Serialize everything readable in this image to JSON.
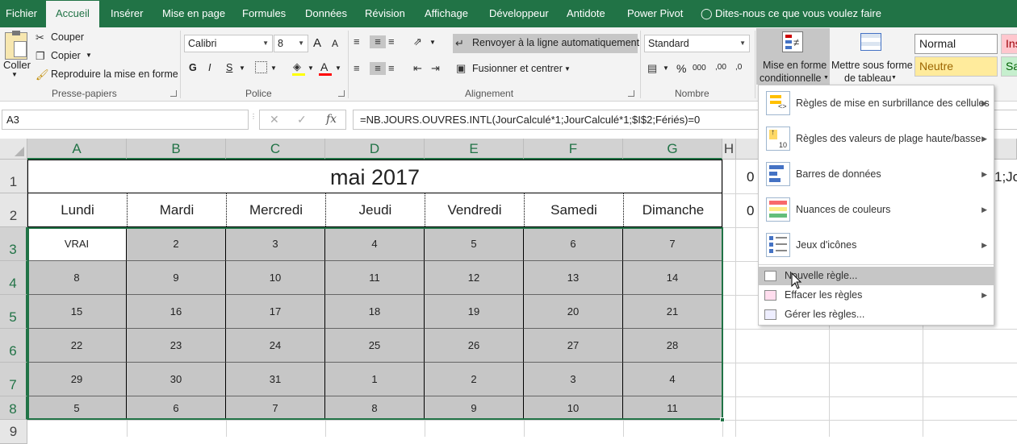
{
  "tabs": [
    "Fichier",
    "Accueil",
    "Insérer",
    "Mise en page",
    "Formules",
    "Données",
    "Révision",
    "Affichage",
    "Développeur",
    "Antidote",
    "Power Pivot",
    "Dites-nous ce que vous voulez faire"
  ],
  "ribbon": {
    "clipboard": {
      "paste": "Coller",
      "cut": "Couper",
      "copy": "Copier",
      "format_painter": "Reproduire la mise en forme",
      "group": "Presse-papiers"
    },
    "font": {
      "name": "Calibri",
      "size": "8",
      "group": "Police",
      "bold": "G",
      "italic": "I",
      "underline": "S",
      "grow": "A",
      "shrink": "A"
    },
    "alignment": {
      "wrap": "Renvoyer à la ligne automatiquement",
      "merge": "Fusionner et centrer",
      "group": "Alignement"
    },
    "number": {
      "format": "Standard",
      "percent": "%",
      "thousands": "000",
      "group": "Nombre",
      "increase": ",00",
      "decrease": ",0"
    },
    "cond_format": {
      "line1": "Mise en forme",
      "line2": "conditionnelle"
    },
    "table_format": {
      "line1": "Mettre sous forme",
      "line2": "de tableau"
    },
    "styles": {
      "normal": "Normal",
      "neutral": "Neutre",
      "ins": "Ins",
      "sa": "Sa"
    }
  },
  "formula_bar": {
    "name_box": "A3",
    "cancel": "✕",
    "enter": "✓",
    "fx": "fx",
    "formula": "=NB.JOURS.OUVRES.INTL(JourCalculé*1;JourCalculé*1;$I$2;Fériés)=0"
  },
  "columns": [
    "A",
    "B",
    "C",
    "D",
    "E",
    "F",
    "G",
    "H"
  ],
  "rows": [
    "1",
    "2",
    "3",
    "4",
    "5",
    "6",
    "7",
    "8",
    "9"
  ],
  "sheet": {
    "title": "mai 2017",
    "days": [
      "Lundi",
      "Mardi",
      "Mercredi",
      "Jeudi",
      "Vendredi",
      "Samedi",
      "Dimanche"
    ],
    "weeks": [
      [
        "VRAI",
        "2",
        "3",
        "4",
        "5",
        "6",
        "7"
      ],
      [
        "8",
        "9",
        "10",
        "11",
        "12",
        "13",
        "14"
      ],
      [
        "15",
        "16",
        "17",
        "18",
        "19",
        "20",
        "21"
      ],
      [
        "22",
        "23",
        "24",
        "25",
        "26",
        "27",
        "28"
      ],
      [
        "29",
        "30",
        "31",
        "1",
        "2",
        "3",
        "4"
      ],
      [
        "5",
        "6",
        "7",
        "8",
        "9",
        "10",
        "11"
      ]
    ],
    "i1": "0",
    "i2": "0",
    "j1": "1;Jo"
  },
  "menu": {
    "items": [
      {
        "label": "Règles de mise en surbrillance des cellules"
      },
      {
        "label": "Règles des valeurs de plage haute/basse"
      },
      {
        "label": "Barres de données"
      },
      {
        "label": "Nuances de couleurs"
      },
      {
        "label": "Jeux d'icônes"
      }
    ],
    "small": [
      {
        "label": "Nouvelle règle..."
      },
      {
        "label": "Effacer les règles"
      },
      {
        "label": "Gérer les règles..."
      }
    ]
  },
  "colors": {
    "accent": "#217346",
    "selection_fill": "#c6c6c6",
    "neutral_fill": "#ffeb9c",
    "neutral_text": "#9c6500",
    "bad_fill": "#ffc7ce",
    "bad_text": "#9c0006",
    "good_fill": "#c6efce",
    "good_text": "#006100"
  }
}
